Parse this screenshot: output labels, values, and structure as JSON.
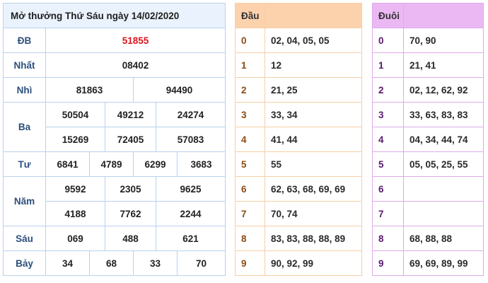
{
  "results": {
    "title": "Mở thưởng Thứ Sáu ngày 14/02/2020",
    "db": {
      "label": "ĐB",
      "values": [
        "51855"
      ]
    },
    "nhat": {
      "label": "Nhất",
      "values": [
        "08402"
      ]
    },
    "nhi": {
      "label": "Nhì",
      "values": [
        "81863",
        "94490"
      ]
    },
    "ba": {
      "label": "Ba",
      "values": [
        "50504",
        "49212",
        "24274",
        "15269",
        "72405",
        "57083"
      ]
    },
    "tu": {
      "label": "Tư",
      "values": [
        "6841",
        "4789",
        "6299",
        "3683"
      ]
    },
    "nam": {
      "label": "Năm",
      "values": [
        "9592",
        "2305",
        "9625",
        "4188",
        "7762",
        "2244"
      ]
    },
    "sau": {
      "label": "Sáu",
      "values": [
        "069",
        "488",
        "621"
      ]
    },
    "bay": {
      "label": "Bảy",
      "values": [
        "34",
        "68",
        "33",
        "70"
      ]
    }
  },
  "dau": {
    "header_key": "Đầu",
    "header_val": "",
    "rows": [
      {
        "key": "0",
        "val": "02, 04, 05, 05"
      },
      {
        "key": "1",
        "val": "12"
      },
      {
        "key": "2",
        "val": "21, 25"
      },
      {
        "key": "3",
        "val": "33, 34"
      },
      {
        "key": "4",
        "val": "41, 44"
      },
      {
        "key": "5",
        "val": "55"
      },
      {
        "key": "6",
        "val": "62, 63, 68, 69, 69"
      },
      {
        "key": "7",
        "val": "70, 74"
      },
      {
        "key": "8",
        "val": "83, 83, 88, 88, 89"
      },
      {
        "key": "9",
        "val": "90, 92, 99"
      }
    ]
  },
  "duoi": {
    "header_key": "Đuôi",
    "header_val": "",
    "rows": [
      {
        "key": "0",
        "val": "70, 90"
      },
      {
        "key": "1",
        "val": "21, 41"
      },
      {
        "key": "2",
        "val": "02, 12, 62, 92"
      },
      {
        "key": "3",
        "val": "33, 63, 83, 83"
      },
      {
        "key": "4",
        "val": "04, 34, 44, 74"
      },
      {
        "key": "5",
        "val": "05, 05, 25, 55"
      },
      {
        "key": "6",
        "val": ""
      },
      {
        "key": "7",
        "val": ""
      },
      {
        "key": "8",
        "val": "68, 88, 88"
      },
      {
        "key": "9",
        "val": "69, 69, 89, 99"
      }
    ]
  },
  "colors": {
    "special_prize": "#e0141b",
    "prize_label": "#2d4f7d",
    "results_header_bg": "#eaf3fd",
    "dau_header_bg": "#fcd2ad",
    "duoi_header_bg": "#ebb8f4"
  }
}
